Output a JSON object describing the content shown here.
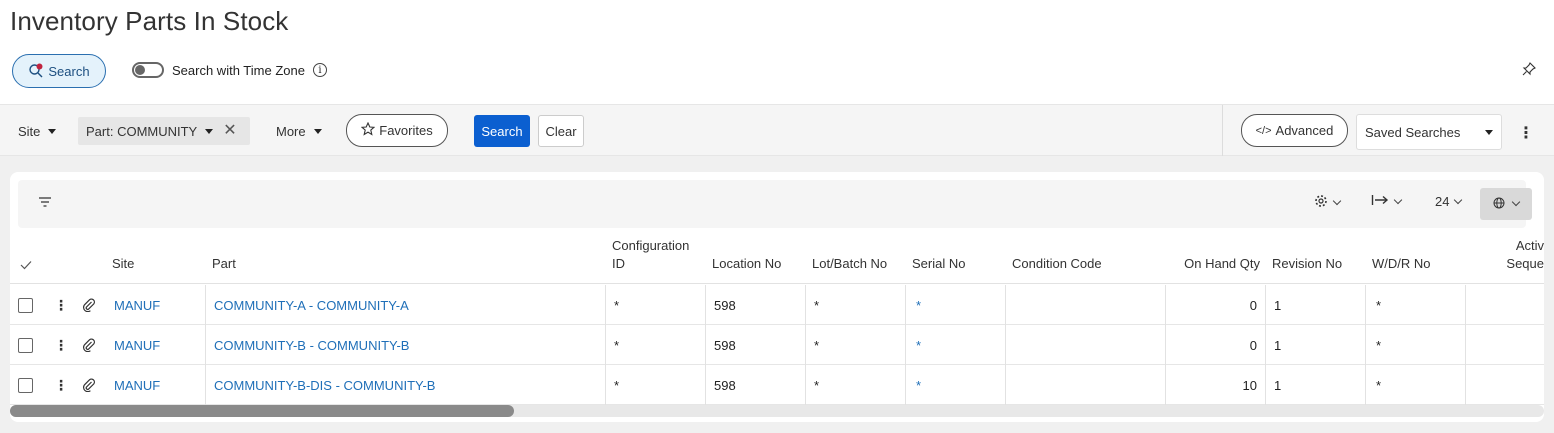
{
  "page": {
    "title": "Inventory Parts In Stock"
  },
  "search_panel": {
    "search_label": "Search",
    "time_zone_label": "Search with Time Zone",
    "info_glyph": "i"
  },
  "filter_bar": {
    "site_label": "Site",
    "part_chip_label": "Part: COMMUNITY",
    "more_label": "More",
    "favorites_label": "Favorites",
    "search_button": "Search",
    "clear_button": "Clear",
    "advanced_label": "Advanced",
    "saved_searches_label": "Saved Searches",
    "advanced_glyph": "</>"
  },
  "table_toolbar": {
    "page_size": "24"
  },
  "table": {
    "columns": {
      "site": "Site",
      "part": "Part",
      "configuration_id": "Configuration ID",
      "location_no": "Location No",
      "lot_batch_no": "Lot/Batch No",
      "serial_no": "Serial No",
      "condition_code": "Condition Code",
      "on_hand_qty": "On Hand Qty",
      "revision_no": "Revision No",
      "wdr_no": "W/D/R No",
      "activity_sequence": "Activ Seque"
    },
    "rows": [
      {
        "site": "MANUF",
        "part": "COMMUNITY-A - COMMUNITY-A",
        "configuration_id": "*",
        "location_no": "598",
        "lot_batch_no": "*",
        "serial_no": "*",
        "condition_code": "",
        "on_hand_qty": "0",
        "revision_no": "1",
        "wdr_no": "*"
      },
      {
        "site": "MANUF",
        "part": "COMMUNITY-B - COMMUNITY-B",
        "configuration_id": "*",
        "location_no": "598",
        "lot_batch_no": "*",
        "serial_no": "*",
        "condition_code": "",
        "on_hand_qty": "0",
        "revision_no": "1",
        "wdr_no": "*"
      },
      {
        "site": "MANUF",
        "part": "COMMUNITY-B-DIS - COMMUNITY-B",
        "configuration_id": "*",
        "location_no": "598",
        "lot_batch_no": "*",
        "serial_no": "*",
        "condition_code": "",
        "on_hand_qty": "10",
        "revision_no": "1",
        "wdr_no": "*"
      }
    ]
  },
  "colors": {
    "primary": "#0b5fd0",
    "link": "#1f6fb8",
    "search_pill_bg": "#e4f2fb",
    "notification_dot": "#c0233f"
  },
  "icons": [
    "search-icon",
    "info-icon",
    "pin-icon",
    "close-icon",
    "star-icon",
    "code-icon",
    "kebab-icon",
    "filter-icon",
    "gear-icon",
    "column-width-icon",
    "globe-icon",
    "check-icon",
    "attachment-icon"
  ]
}
